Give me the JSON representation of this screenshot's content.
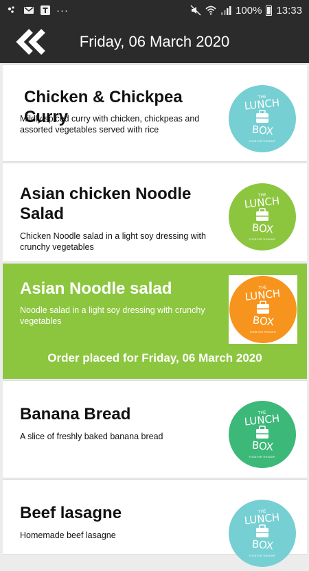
{
  "status": {
    "battery": "100%",
    "time": "13:33"
  },
  "header": {
    "title": "Friday, 06 March 2020",
    "back_icon": "double-chevron-left-icon"
  },
  "logo_text": {
    "the": "THE",
    "lunch": "LUNCH",
    "box": "BOX",
    "tagline": "FOOD FOR THOUGHT"
  },
  "items": [
    {
      "title": "Chicken & Chickpea Curry",
      "description": "Mildly spiced curry with chicken, chickpeas and assorted vegetables served with rice",
      "logo_color": "#76cfd3"
    },
    {
      "title": "Asian chicken Noodle Salad",
      "description": "Chicken Noodle salad in a light soy dressing with crunchy vegetables",
      "logo_color": "#8cc63f"
    },
    {
      "title": "Asian Noodle salad",
      "description": "Noodle salad in a light soy dressing with crunchy vegetables",
      "logo_color": "#f7941d",
      "selected": true,
      "order_note": "Order placed for Friday, 06 March 2020"
    },
    {
      "title": "Banana Bread",
      "description": "A slice of freshly baked banana bread",
      "logo_color": "#3cb878"
    },
    {
      "title": "Beef lasagne",
      "description": "Homemade beef lasagne",
      "logo_color": "#76cfd3"
    }
  ],
  "colors": {
    "header_bg": "#2b2b2b",
    "selected_bg": "#8cc63f",
    "list_bg": "#ececec"
  }
}
